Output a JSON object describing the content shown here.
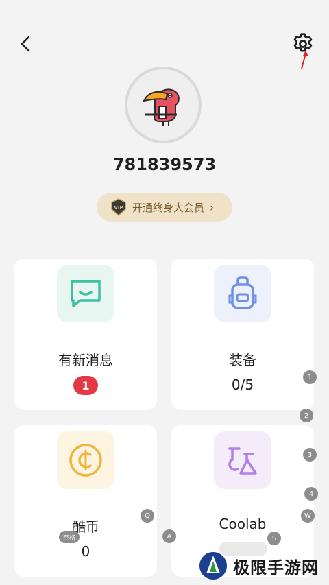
{
  "header": {
    "back_icon": "chevron-left-icon",
    "settings_icon": "gear-icon"
  },
  "profile": {
    "username": "781839573",
    "vip_badge_text": "VIP",
    "vip_label": "开通终身大会员",
    "vip_chevron": "›"
  },
  "cards": [
    {
      "title": "有新消息",
      "value": "1",
      "icon": "chat-bubble-icon",
      "accent": "#3dbfa3"
    },
    {
      "title": "装备",
      "value": "0/5",
      "icon": "backpack-icon",
      "accent": "#6f8fe6"
    },
    {
      "title": "酷币",
      "value": "0",
      "icon": "coin-icon",
      "accent": "#f2b43c"
    },
    {
      "title": "Coolab",
      "value": "",
      "icon": "flask-icon",
      "accent": "#b27ee8"
    }
  ],
  "overlay_keys": [
    "1",
    "2",
    "3",
    "4",
    "Q",
    "W",
    "A",
    "S",
    "空格"
  ],
  "watermark": {
    "text": "极限手游网"
  },
  "colors": {
    "background": "#f3f3f4",
    "card": "#ffffff",
    "badge_red": "#e53845",
    "vip_bg": "#efe2c8",
    "vip_text": "#7a5a2b"
  }
}
